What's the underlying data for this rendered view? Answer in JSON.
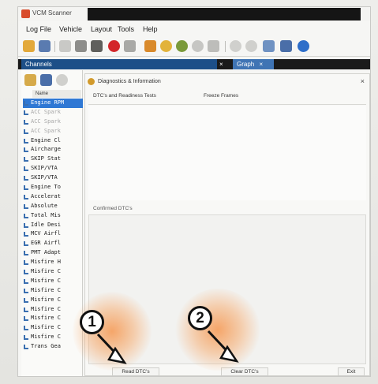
{
  "window": {
    "title": "VCM Scanner"
  },
  "menu": [
    "Log File",
    "Vehicle",
    "Layout",
    "Tools",
    "Help"
  ],
  "tabs": {
    "channels": "Channels",
    "graph": "Graph"
  },
  "channels": {
    "header": "Name",
    "items": [
      {
        "label": "Engine RPM",
        "state": "selected"
      },
      {
        "label": "ACC Spark",
        "state": "faded"
      },
      {
        "label": "ACC Spark",
        "state": "faded"
      },
      {
        "label": "ACC Spark",
        "state": "faded"
      },
      {
        "label": "Engine Cl",
        "state": "normal"
      },
      {
        "label": "Aircharge",
        "state": "normal"
      },
      {
        "label": "SKIP Stat",
        "state": "normal"
      },
      {
        "label": "SKIP/VTA",
        "state": "normal"
      },
      {
        "label": "SKIP/VTA",
        "state": "normal"
      },
      {
        "label": "Engine To",
        "state": "normal"
      },
      {
        "label": "Accelerat",
        "state": "normal"
      },
      {
        "label": "Absolute",
        "state": "normal"
      },
      {
        "label": "Total Mis",
        "state": "normal"
      },
      {
        "label": "Idle Desi",
        "state": "normal"
      },
      {
        "label": "MCV Airfl",
        "state": "normal"
      },
      {
        "label": "EGR Airfl",
        "state": "normal"
      },
      {
        "label": "PMT Adapt",
        "state": "normal"
      },
      {
        "label": "Misfire H",
        "state": "normal"
      },
      {
        "label": "Misfire C",
        "state": "normal"
      },
      {
        "label": "Misfire C",
        "state": "normal"
      },
      {
        "label": "Misfire C",
        "state": "normal"
      },
      {
        "label": "Misfire C",
        "state": "normal"
      },
      {
        "label": "Misfire C",
        "state": "normal"
      },
      {
        "label": "Misfire C",
        "state": "normal"
      },
      {
        "label": "Misfire C",
        "state": "normal"
      },
      {
        "label": "Misfire C",
        "state": "normal"
      },
      {
        "label": "Trans Gea",
        "state": "normal"
      }
    ]
  },
  "diagnostics": {
    "title": "Diagnostics & Information",
    "tab_dtcs": "DTC's and Readiness Tests",
    "tab_freeze": "Freeze Frames",
    "confirmed_label": "Confirmed DTC's",
    "read_button": "Read DTC's",
    "clear_button": "Clear DTC's",
    "exit_button": "Exit"
  },
  "annotations": {
    "step1": "1",
    "step2": "2"
  },
  "colors": {
    "highlight": "#f68c3c",
    "selection": "#2f78d4",
    "tab_active": "#1d4f88"
  }
}
